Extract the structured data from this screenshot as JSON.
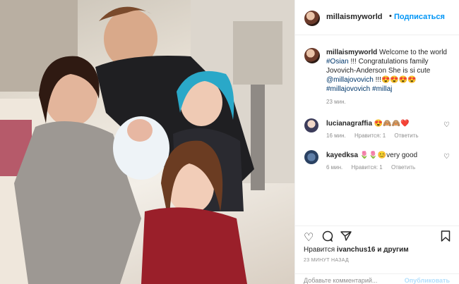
{
  "header": {
    "username": "millaismyworld",
    "dot": "•",
    "follow_label": "Подписаться"
  },
  "caption": {
    "username": "millaismyworld",
    "text_1": "Welcome to the world",
    "tag_osian": "#Osian",
    "text_2": "!!! Congratulations family Jovovich-Anderson She is si cute",
    "mention": "@millajovovich",
    "text_3": "!!!😍😍😍😍",
    "tags_end": "#millajovovich #millaj",
    "time": "23 мин."
  },
  "comments": [
    {
      "username": "lucianagraffia",
      "text": "😍🙈🙈❤️",
      "time": "16 мин.",
      "likes": "Нравится: 1",
      "reply": "Ответить"
    },
    {
      "username": "kayedksa",
      "text": "🌷🌷😊very good",
      "time": "6 мин.",
      "likes": "Нравится: 1",
      "reply": "Ответить"
    }
  ],
  "actions": {
    "like_icon": "heart-icon",
    "comment_icon": "comment-icon",
    "share_icon": "share-icon",
    "save_icon": "bookmark-icon"
  },
  "likes": {
    "prefix": "Нравится",
    "user": "ivanchus16",
    "suffix": "и другим"
  },
  "post_time": "23 МИНУТ НАЗАД",
  "add_comment": {
    "placeholder": "Добавьте комментарий...",
    "publish": "Опубликовать"
  },
  "colors": {
    "link": "#0095f6",
    "tag": "#00376b",
    "muted": "#8e8e8e"
  }
}
